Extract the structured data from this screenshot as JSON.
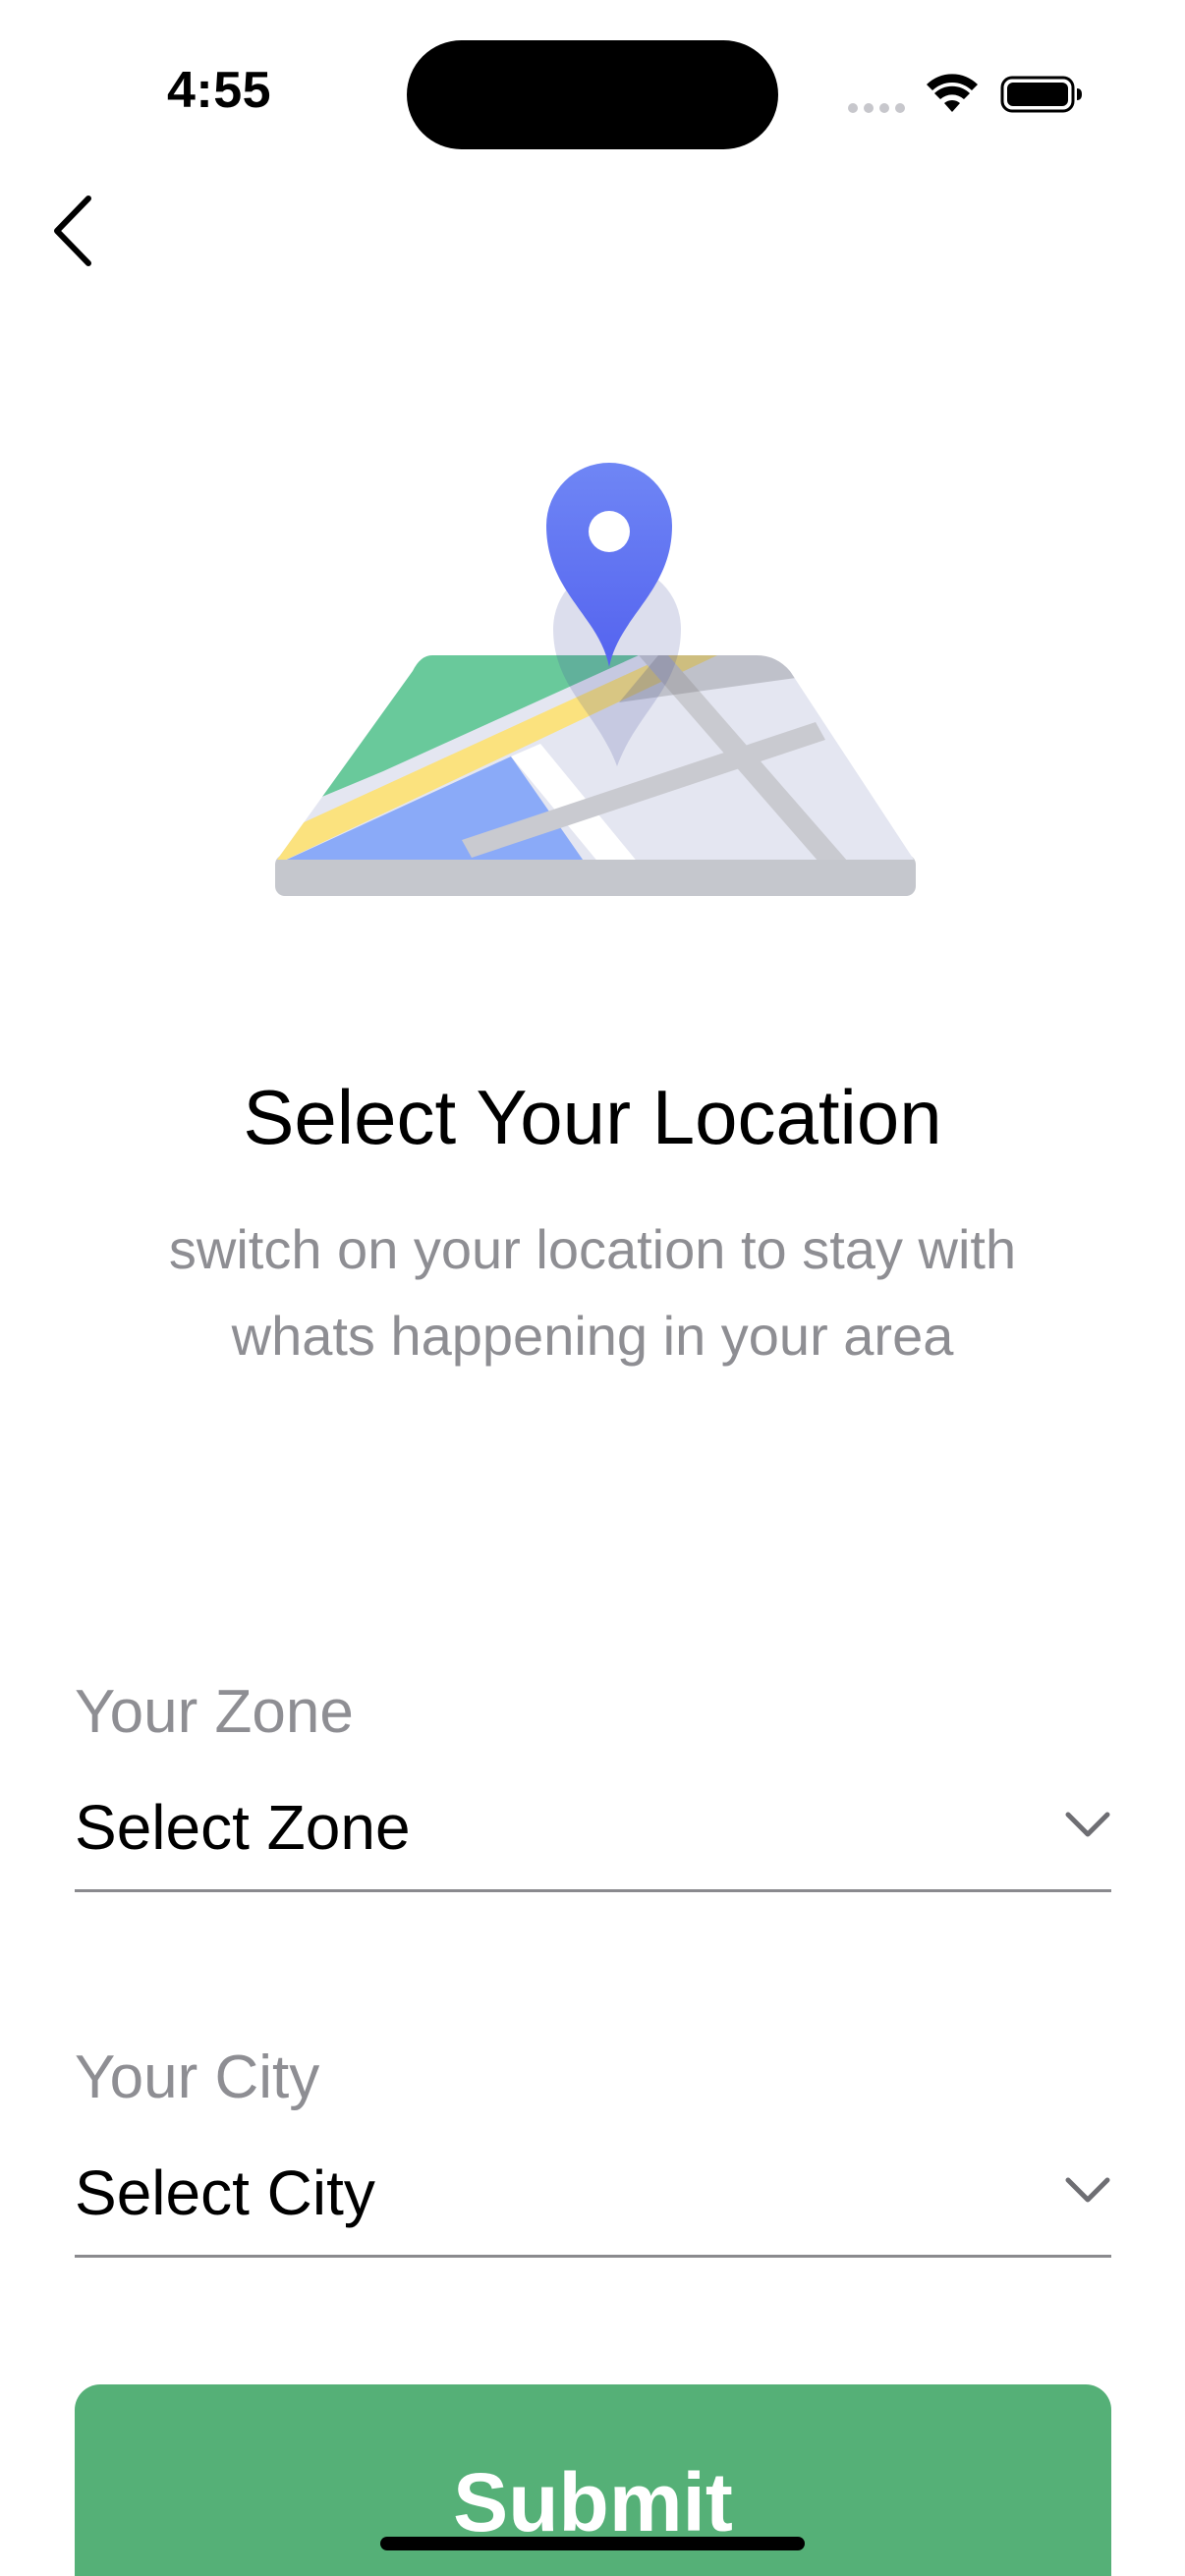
{
  "status_bar": {
    "time": "4:55",
    "icons": [
      "cellular-signal-icon",
      "wifi-icon",
      "battery-icon"
    ]
  },
  "nav": {
    "back_icon": "chevron-left-icon"
  },
  "illustration": {
    "icon": "map-location-pin-icon",
    "pin_color": "#5f72f2"
  },
  "header": {
    "title": "Select Your Location",
    "subtitle_line1": "switch on your location to stay with",
    "subtitle_line2": "whats happening in your area"
  },
  "form": {
    "zone": {
      "label": "Your Zone",
      "value": "Select Zone",
      "icon": "chevron-down-icon"
    },
    "city": {
      "label": "Your City",
      "value": "Select City",
      "icon": "chevron-down-icon"
    }
  },
  "actions": {
    "submit_label": "Submit",
    "submit_color": "#55b077"
  }
}
